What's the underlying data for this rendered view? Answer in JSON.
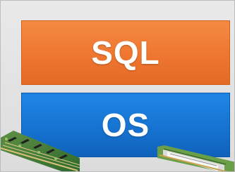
{
  "stack": {
    "layers": [
      {
        "label": "SQL",
        "color": "#ee7630"
      },
      {
        "label": "OS",
        "color": "#1673d1"
      }
    ]
  },
  "decorations": {
    "left_image": "circuit-board-icon",
    "right_image": "hardware-card-icon"
  }
}
